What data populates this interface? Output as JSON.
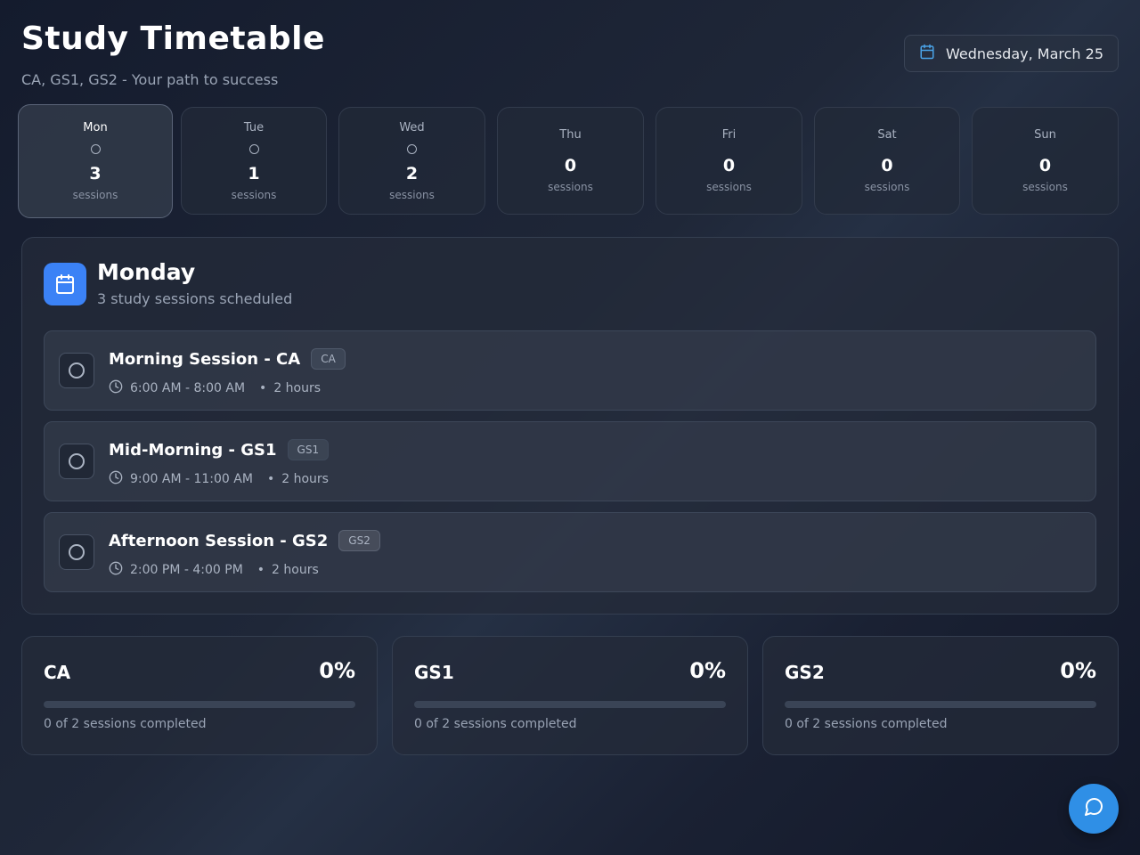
{
  "header": {
    "title": "Study Timetable",
    "subtitle": "CA, GS1, GS2 - Your path to success",
    "date": "Wednesday, March 25"
  },
  "days": [
    {
      "name": "Mon",
      "count": "3",
      "label": "sessions",
      "active": true,
      "has_sessions": true
    },
    {
      "name": "Tue",
      "count": "1",
      "label": "sessions",
      "active": false,
      "has_sessions": true
    },
    {
      "name": "Wed",
      "count": "2",
      "label": "sessions",
      "active": false,
      "has_sessions": true
    },
    {
      "name": "Thu",
      "count": "0",
      "label": "sessions",
      "active": false,
      "has_sessions": false
    },
    {
      "name": "Fri",
      "count": "0",
      "label": "sessions",
      "active": false,
      "has_sessions": false
    },
    {
      "name": "Sat",
      "count": "0",
      "label": "sessions",
      "active": false,
      "has_sessions": false
    },
    {
      "name": "Sun",
      "count": "0",
      "label": "sessions",
      "active": false,
      "has_sessions": false
    }
  ],
  "schedule": {
    "day_title": "Monday",
    "summary": "3 study sessions scheduled",
    "sessions": [
      {
        "title": "Morning Session - CA",
        "tag": "CA",
        "time": "6:00 AM - 8:00 AM",
        "duration": "2 hours"
      },
      {
        "title": "Mid-Morning - GS1",
        "tag": "GS1",
        "time": "9:00 AM - 11:00 AM",
        "duration": "2 hours"
      },
      {
        "title": "Afternoon Session - GS2",
        "tag": "GS2",
        "time": "2:00 PM - 4:00 PM",
        "duration": "2 hours"
      }
    ]
  },
  "progress": [
    {
      "name": "CA",
      "percent": "0%",
      "fraction": 0,
      "text": "0 of 2 sessions completed"
    },
    {
      "name": "GS1",
      "percent": "0%",
      "fraction": 0,
      "text": "0 of 2 sessions completed"
    },
    {
      "name": "GS2",
      "percent": "0%",
      "fraction": 0,
      "text": "0 of 2 sessions completed"
    }
  ],
  "separator": "•",
  "colors": {
    "accent": "#3b82f6",
    "chat": "#2f8fe6"
  },
  "icons": {
    "date": "calendar-icon",
    "panel": "calendar-icon",
    "time": "clock-icon",
    "chat": "message-circle-icon"
  }
}
